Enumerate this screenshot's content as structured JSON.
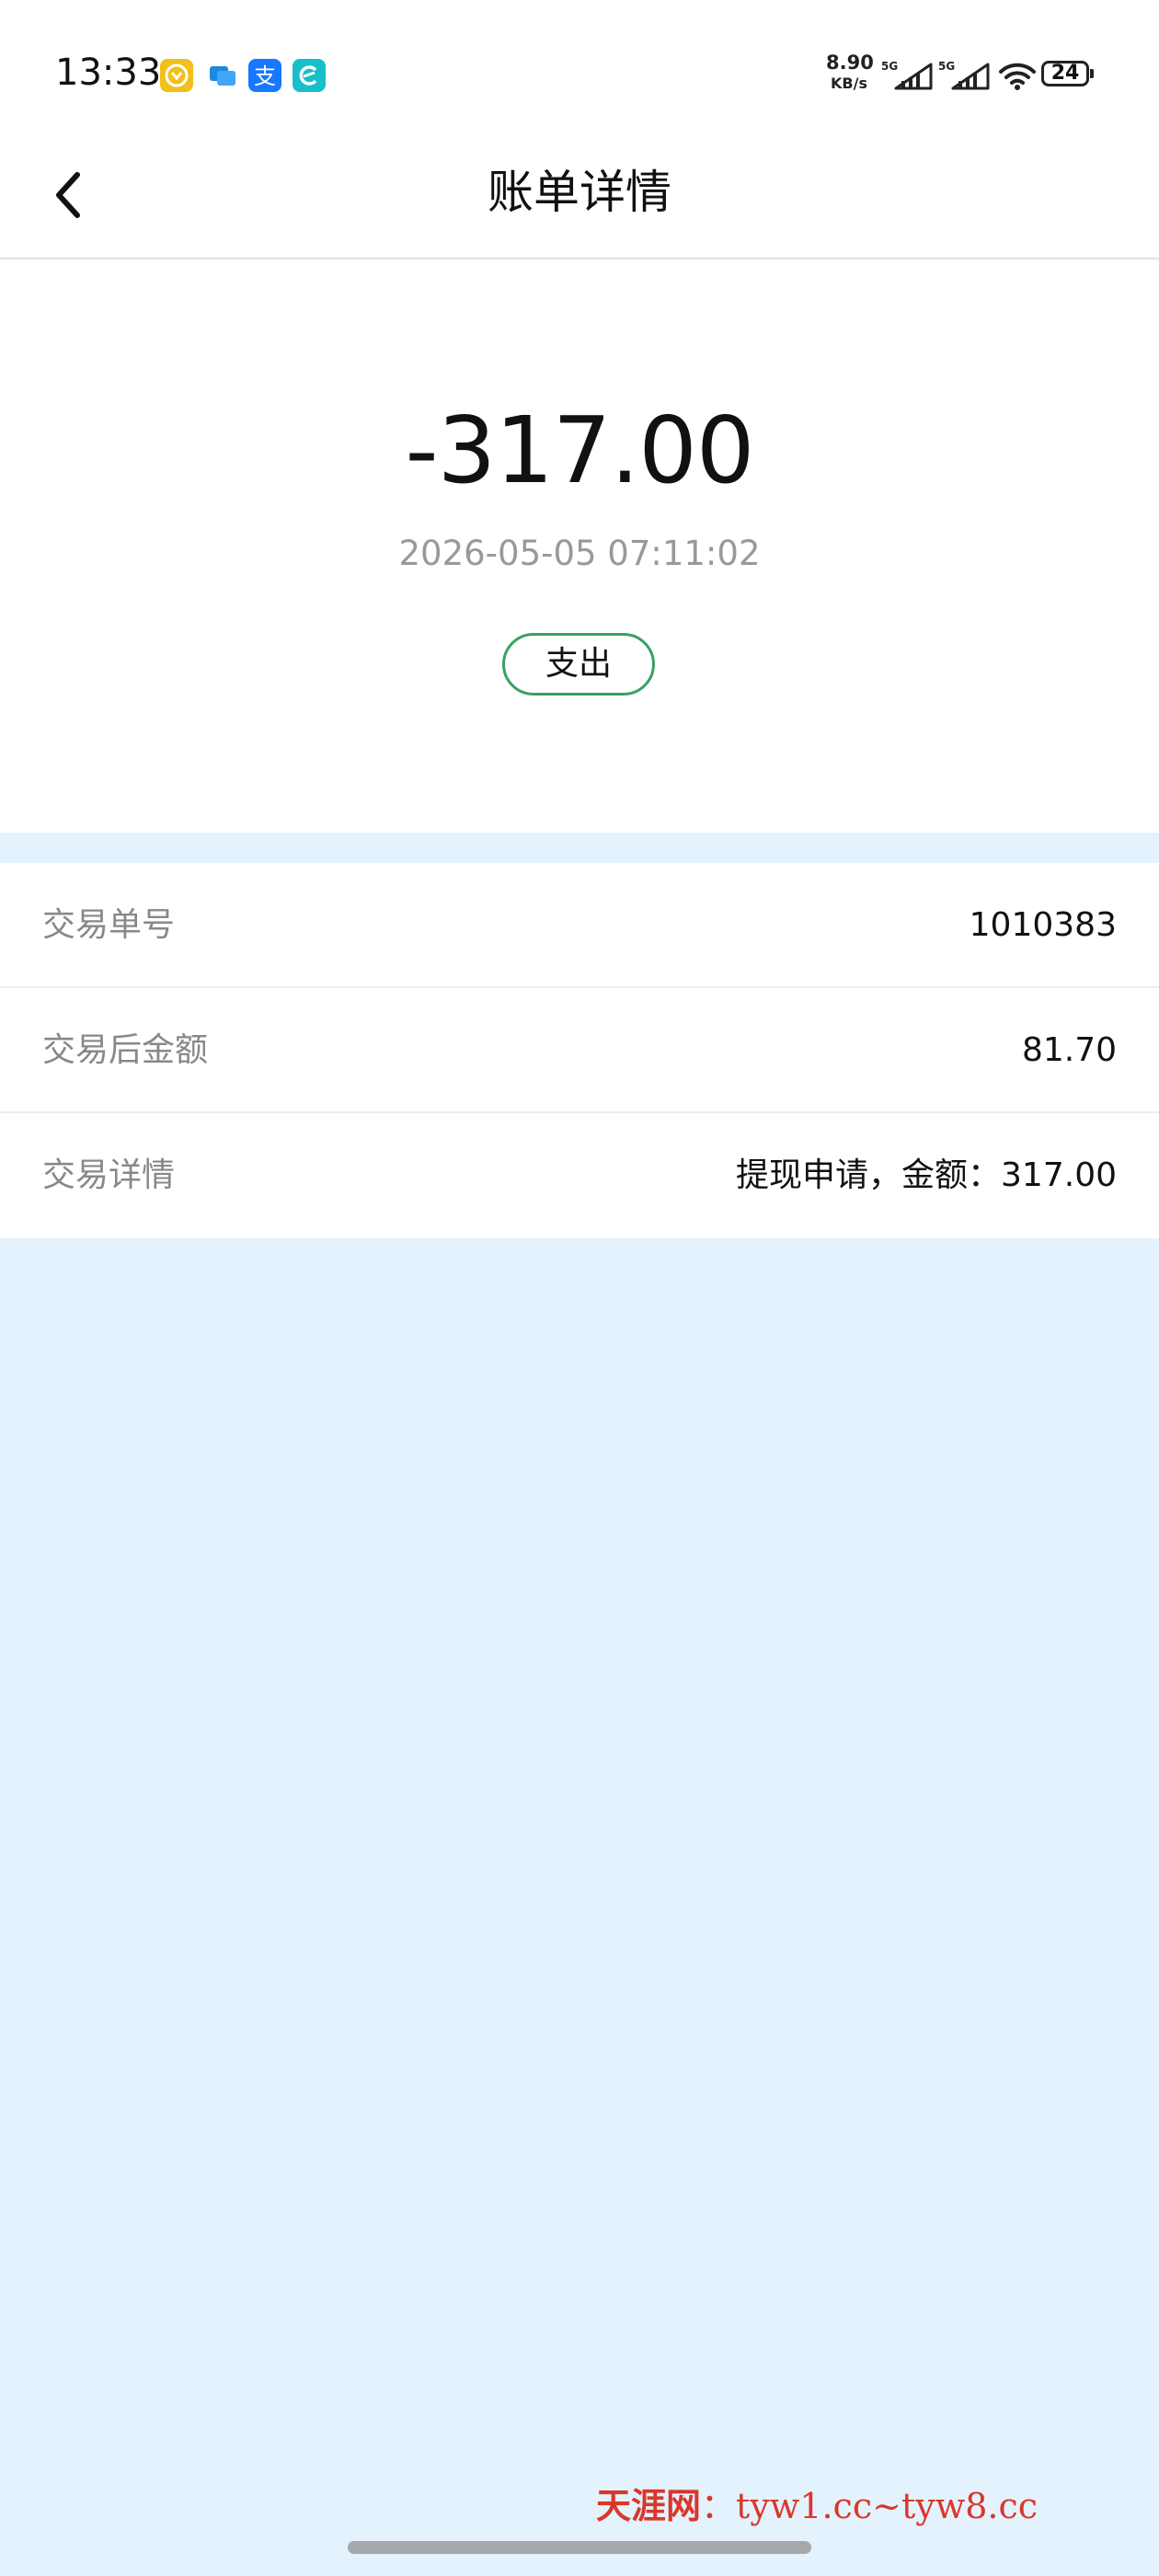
{
  "status_bar": {
    "time": "13:33",
    "net_speed_value": "8.90",
    "net_speed_unit": "KB/s",
    "sim1_label": "5G",
    "sim2_label": "5G",
    "battery": "24",
    "app_icons": [
      "coin-app-icon",
      "chat-app-icon",
      "alipay-icon",
      "browser-app-icon"
    ]
  },
  "nav": {
    "title": "账单详情",
    "back_icon": "chevron-left-icon"
  },
  "summary": {
    "amount": "-317.00",
    "datetime": "2026-05-05 07:11:02",
    "type_badge": "支出",
    "badge_color": "#3aa061"
  },
  "details": [
    {
      "label": "交易单号",
      "value": "1010383"
    },
    {
      "label": "交易后金额",
      "value": "81.70"
    },
    {
      "label": "交易详情",
      "value": "提现申请，金额：317.00"
    }
  ],
  "watermark": {
    "brand": "天涯网",
    "separator": "：",
    "url": "tyw1.cc~tyw8.cc"
  },
  "colors": {
    "page_background": "#e3f2fd",
    "card_background": "#ffffff",
    "watermark": "#d9372b"
  }
}
